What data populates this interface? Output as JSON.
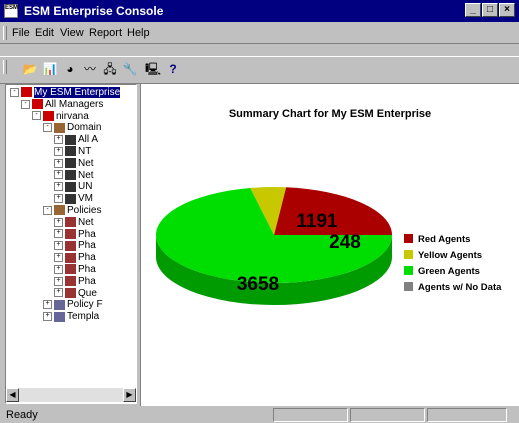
{
  "window": {
    "title": "ESM Enterprise Console",
    "app_icon_text": "ESM"
  },
  "menu": [
    "File",
    "Edit",
    "View",
    "Report",
    "Help"
  ],
  "toolbar": [
    {
      "name": "open-folder-icon",
      "glyph": "📂"
    },
    {
      "name": "bar-chart-icon",
      "glyph": "📊"
    },
    {
      "name": "pie-chart-icon",
      "glyph": "◕"
    },
    {
      "name": "line-chart-icon",
      "glyph": "〰"
    },
    {
      "name": "network-icon",
      "glyph": "🖧"
    },
    {
      "name": "tools-icon",
      "glyph": "🔧"
    },
    {
      "name": "computer-icon",
      "glyph": "🖳"
    },
    {
      "name": "help-icon",
      "glyph": "?"
    }
  ],
  "tree": [
    {
      "label": "My ESM Enterprise",
      "level": 0,
      "expander": "-",
      "icon": "#cc0000",
      "selected": true
    },
    {
      "label": "All Managers",
      "level": 1,
      "expander": "-",
      "icon": "#cc0000"
    },
    {
      "label": "nirvana",
      "level": 2,
      "expander": "-",
      "icon": "#cc0000"
    },
    {
      "label": "Domain",
      "level": 3,
      "expander": "-",
      "icon": "#996633"
    },
    {
      "label": "All A",
      "level": 4,
      "expander": "+",
      "icon": "#333333"
    },
    {
      "label": "NT",
      "level": 4,
      "expander": "+",
      "icon": "#333333"
    },
    {
      "label": "Net",
      "level": 4,
      "expander": "+",
      "icon": "#333333"
    },
    {
      "label": "Net",
      "level": 4,
      "expander": "+",
      "icon": "#333333"
    },
    {
      "label": "UN",
      "level": 4,
      "expander": "+",
      "icon": "#333333"
    },
    {
      "label": "VM",
      "level": 4,
      "expander": "+",
      "icon": "#333333"
    },
    {
      "label": "Policies",
      "level": 3,
      "expander": "-",
      "icon": "#996633"
    },
    {
      "label": "Net",
      "level": 4,
      "expander": "+",
      "icon": "#993333"
    },
    {
      "label": "Pha",
      "level": 4,
      "expander": "+",
      "icon": "#993333"
    },
    {
      "label": "Pha",
      "level": 4,
      "expander": "+",
      "icon": "#993333"
    },
    {
      "label": "Pha",
      "level": 4,
      "expander": "+",
      "icon": "#993333"
    },
    {
      "label": "Pha",
      "level": 4,
      "expander": "+",
      "icon": "#993333"
    },
    {
      "label": "Pha",
      "level": 4,
      "expander": "+",
      "icon": "#993333"
    },
    {
      "label": "Que",
      "level": 4,
      "expander": "+",
      "icon": "#993333"
    },
    {
      "label": "Policy F",
      "level": 3,
      "expander": "+",
      "icon": "#666699"
    },
    {
      "label": "Templa",
      "level": 3,
      "expander": "+",
      "icon": "#666699"
    }
  ],
  "status": {
    "text": "Ready"
  },
  "chart_data": {
    "type": "pie",
    "title": "Summary Chart for My ESM Enterprise",
    "slices": [
      {
        "label": "Red Agents",
        "value": 1191,
        "color": "#aa0000"
      },
      {
        "label": "Yellow Agents",
        "value": 248,
        "color": "#c8c800"
      },
      {
        "label": "Green Agents",
        "value": 3658,
        "color": "#00dd00"
      },
      {
        "label": "Agents w/ No Data",
        "value": 0,
        "color": "#808080"
      }
    ],
    "legend_position": "right"
  }
}
